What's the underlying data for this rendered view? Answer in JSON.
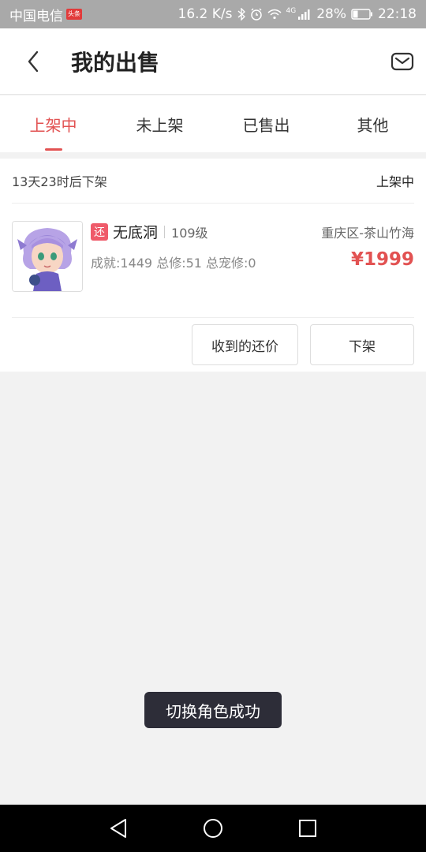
{
  "status_bar": {
    "carrier": "中国电信",
    "news_badge": "头条",
    "net_speed": "16.2 K/s",
    "network": "4G",
    "battery": "28%",
    "time": "22:18"
  },
  "header": {
    "title": "我的出售",
    "back_icon": "chevron-left-icon",
    "mail_icon": "mail-icon"
  },
  "tabs": [
    {
      "label": "上架中",
      "active": true
    },
    {
      "label": "未上架",
      "active": false
    },
    {
      "label": "已售出",
      "active": false
    },
    {
      "label": "其他",
      "active": false
    }
  ],
  "listing": {
    "remaining": "13天23时后下架",
    "state": "上架中",
    "badge": "还",
    "role_name": "无底洞",
    "level": "109级",
    "server": "重庆区-茶山竹海",
    "stats": "成就:1449 总修:51 总宠修:0",
    "price": "¥1999",
    "buttons": {
      "offers": "收到的还价",
      "delist": "下架"
    }
  },
  "toast": "切换角色成功",
  "colors": {
    "accent": "#e25252",
    "badge": "#ef5b6a",
    "status_bar": "#a9a9a9",
    "toast_bg": "#2d2d38"
  }
}
